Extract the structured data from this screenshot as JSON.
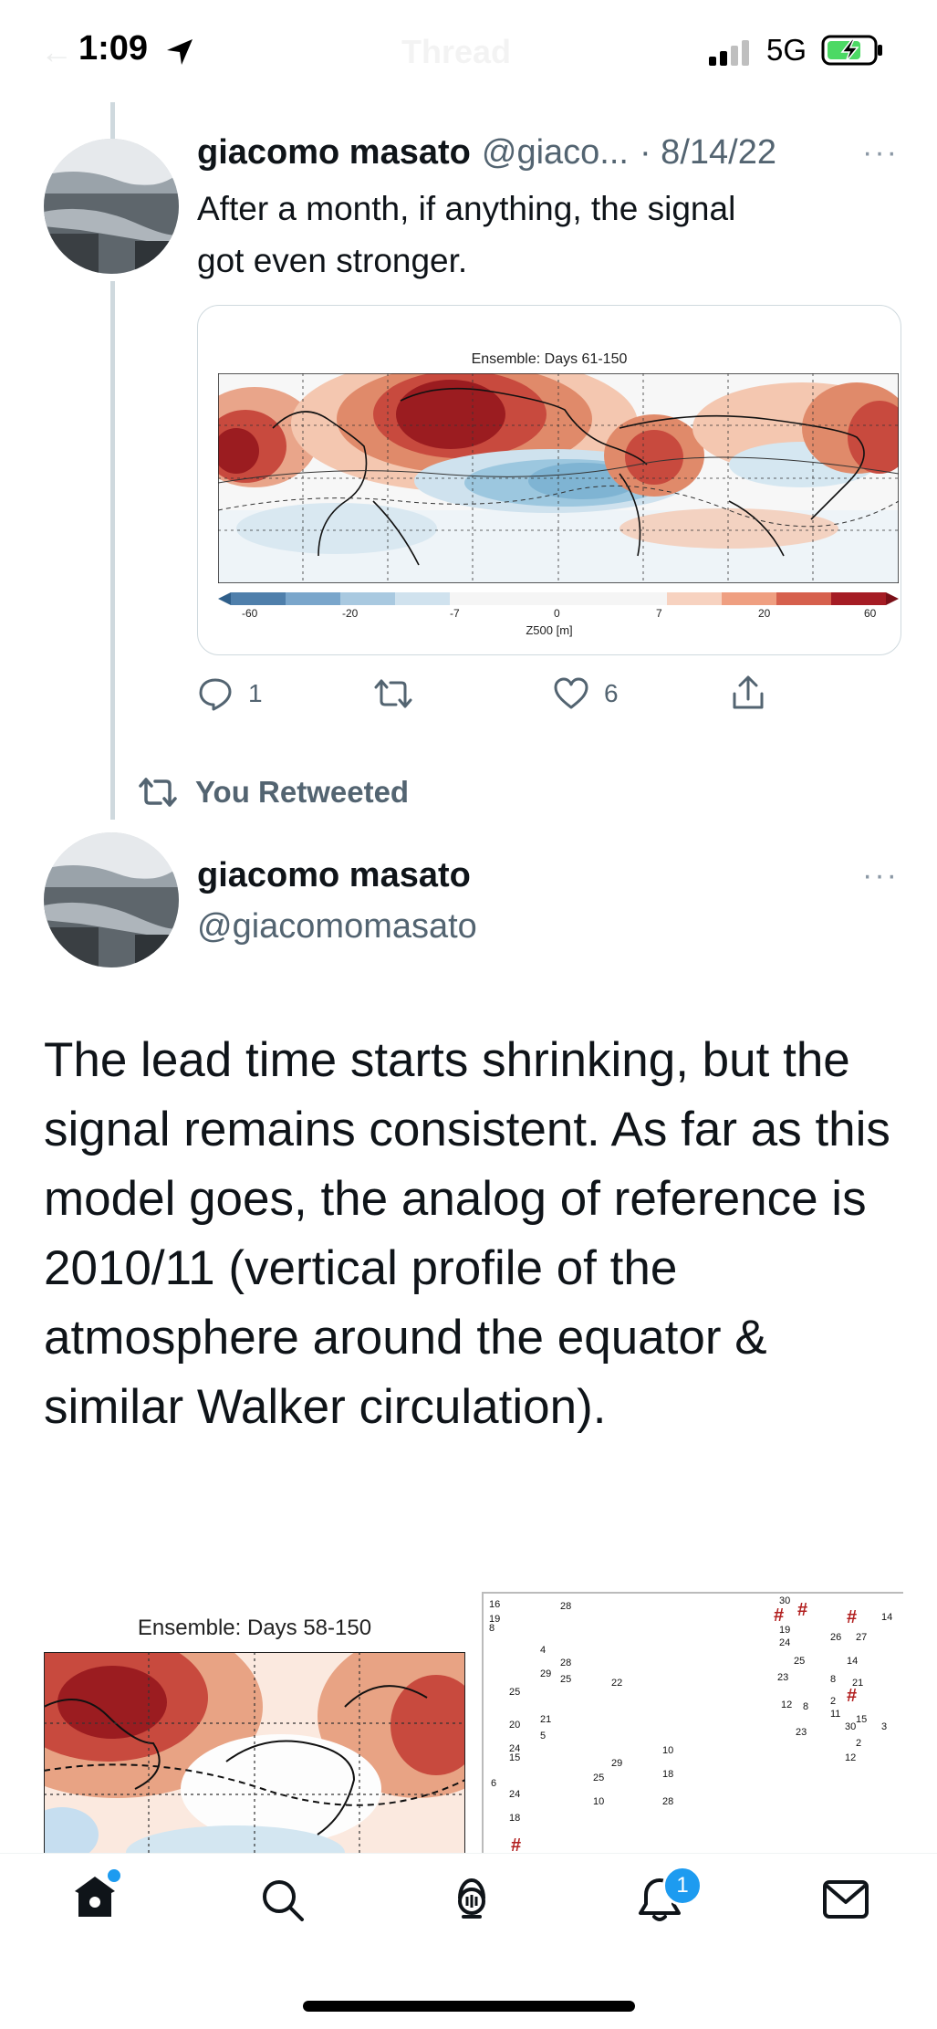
{
  "status_bar": {
    "time": "1:09",
    "network": "5G"
  },
  "header": {
    "title": "Thread"
  },
  "tweet1": {
    "name": "giacomo masato",
    "handle": "@giaco...",
    "date": "· 8/14/22",
    "text_line1": "After a month, if anything, the signal",
    "text_line2": "got even stronger.",
    "media": {
      "title": "Ensemble: Days 61-150",
      "colorbar_ticks": [
        "-60",
        "-20",
        "-7",
        "0",
        "7",
        "20",
        "60"
      ],
      "colorbar_label": "Z500 [m]"
    },
    "replies": "1",
    "likes": "6"
  },
  "retweet_banner": "You Retweeted",
  "tweet2": {
    "name": "giacomo masato",
    "handle": "@giacomomasato",
    "text": "The lead time starts shrinking, but the signal remains consistent. As far as this model goes, the analog of reference is 2010/11 (vertical profile of the atmosphere around the equator & similar Walker circulation).",
    "media_left_title": "Ensemble: Days 58-150",
    "media_right_labels": [
      "16",
      "28",
      "30",
      "19",
      "8",
      "4",
      "28",
      "29",
      "25",
      "22",
      "25",
      "20",
      "21",
      "5",
      "24",
      "15",
      "29",
      "10",
      "25",
      "18",
      "6",
      "24",
      "10",
      "28",
      "18",
      "19",
      "24",
      "26",
      "27",
      "14",
      "8",
      "21",
      "2",
      "12",
      "8",
      "11",
      "15",
      "23",
      "30",
      "2",
      "12",
      "3",
      "14",
      "23",
      "25"
    ]
  },
  "tabbar": {
    "notifications_badge": "1"
  },
  "colors": {
    "accent": "#1d9bf0",
    "text": "#0f1419",
    "secondary": "#536471",
    "warm_dark": "#9b1c20",
    "warm_mid": "#d6604d",
    "warm_light": "#f4a582",
    "cool_light": "#d1e5f0",
    "cool_mid": "#92c5de",
    "cool_dark": "#4393c3"
  }
}
